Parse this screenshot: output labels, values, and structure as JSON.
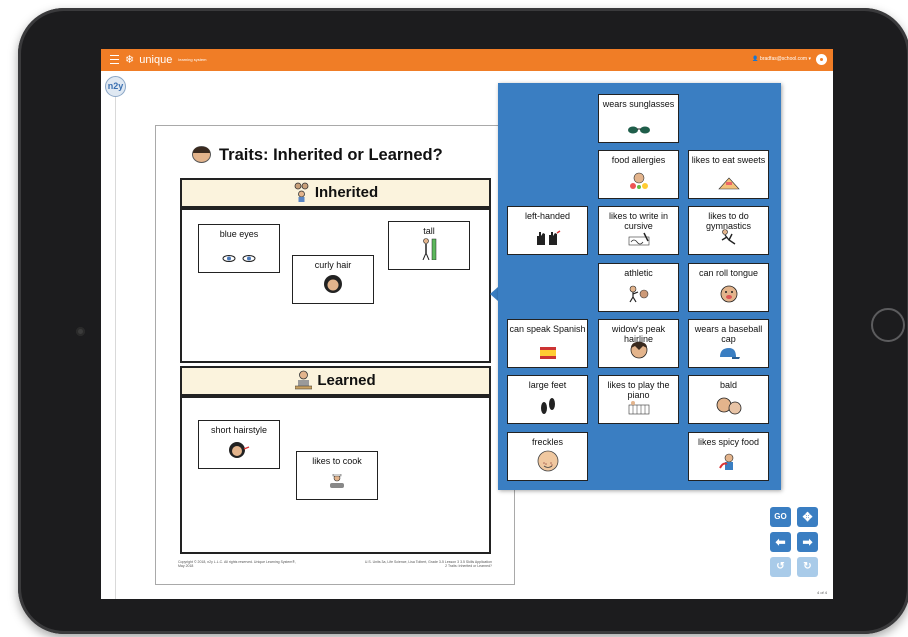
{
  "app": {
    "name": "unique",
    "subtitle": "learning system",
    "user_email": "bradfas@school.com",
    "ub_badge": "n2y"
  },
  "document": {
    "title": "Traits: Inherited or Learned?",
    "sections": {
      "inherited": {
        "label": "Inherited",
        "cards": [
          "blue eyes",
          "tall",
          "curly hair"
        ]
      },
      "learned": {
        "label": "Learned",
        "cards": [
          "short hairstyle",
          "likes to cook"
        ]
      }
    },
    "footer_left": "Copyright © 2018, n2y L.L.C. All rights reserved. Unique Learning System®, May 2018",
    "footer_right": "U.S. Units 3a, Life Science, Lisa Tolbert, Grade 3-5 Lesson 3 3.5 Skills Application 2 Traits: Inherited or Learned?"
  },
  "choices_panel": {
    "cards": [
      "wears sunglasses",
      "food allergies",
      "likes to eat sweets",
      "left-handed",
      "likes to write in cursive",
      "likes to do gymnastics",
      "athletic",
      "can roll tongue",
      "can speak Spanish",
      "widow's peak hairline",
      "wears a baseball cap",
      "large feet",
      "likes to play the piano",
      "bald",
      "freckles",
      "likes spicy food"
    ]
  },
  "controls": {
    "zoom_label": "GO",
    "move_icon": "move-arrows-icon",
    "back_icon": "arrow-left-icon",
    "forward_icon": "arrow-right-icon",
    "page": "4 of 4"
  },
  "colors": {
    "topbar": "#f07d26",
    "panel": "#3a7ec2",
    "section_header_bg": "#fbf3dd",
    "bezel": "#1c1c1e"
  }
}
